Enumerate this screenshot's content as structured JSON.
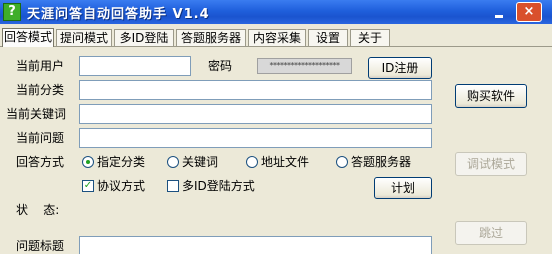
{
  "window": {
    "icon_glyph": "?",
    "title": "天涯问答自动回答助手 V1.4",
    "minimize_glyph": "_",
    "close_glyph": "×"
  },
  "tabs": [
    {
      "label": "回答模式",
      "active": true
    },
    {
      "label": "提问模式",
      "active": false
    },
    {
      "label": "多ID登陆",
      "active": false
    },
    {
      "label": "答题服务器",
      "active": false
    },
    {
      "label": "内容采集",
      "active": false
    },
    {
      "label": "设置",
      "active": false
    },
    {
      "label": "关于",
      "active": false
    }
  ],
  "form": {
    "current_user_label": "当前用户",
    "current_user_value": "",
    "password_label": "密码",
    "password_value": "********************",
    "id_register_button": "ID注册",
    "current_category_label": "当前分类",
    "current_category_value": "",
    "current_keyword_label": "当前关键词",
    "current_keyword_value": "",
    "current_question_label": "当前问题",
    "current_question_value": "",
    "answer_mode_label": "回答方式",
    "answer_modes": [
      {
        "label": "指定分类",
        "selected": true
      },
      {
        "label": "关键词",
        "selected": false
      },
      {
        "label": "地址文件",
        "selected": false
      },
      {
        "label": "答题服务器",
        "selected": false
      }
    ],
    "protocol_mode": {
      "label": "协议方式",
      "checked": true
    },
    "multi_id_mode": {
      "label": "多ID登陆方式",
      "checked": false
    },
    "plan_button": "计划",
    "status_label": "状    态:",
    "question_title_label": "问题标题",
    "question_title_value": ""
  },
  "side_buttons": {
    "buy_software": "购买软件",
    "debug_mode": "调试模式",
    "skip": "跳过"
  },
  "colors": {
    "titlebar": "#1f5fdc",
    "window_bg": "#ece9d8",
    "check_mark": "#21a121"
  }
}
